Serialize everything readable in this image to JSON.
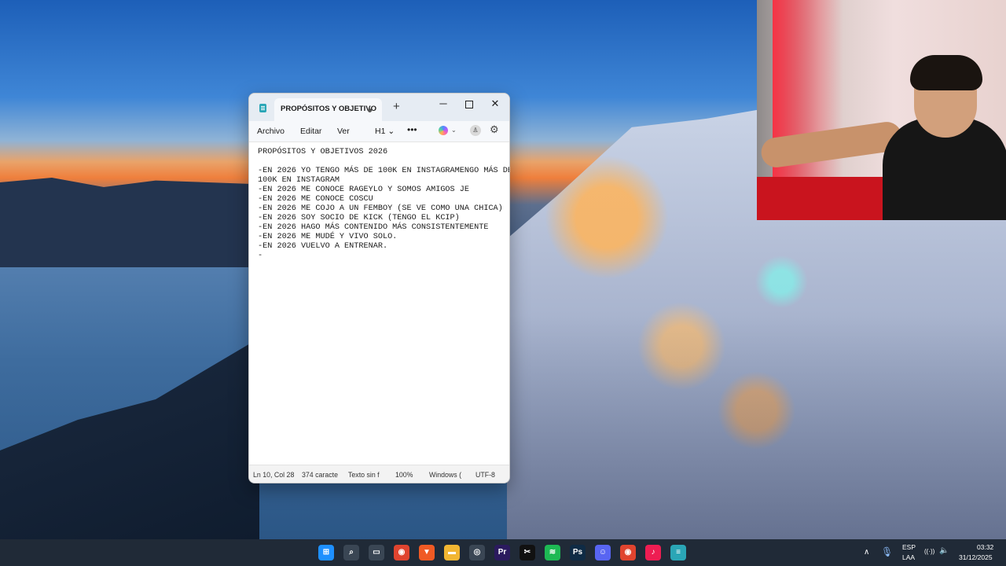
{
  "notepad": {
    "tab_title": "PROPÓSITOS Y OBJETIVO",
    "new_tab": "+",
    "window_controls": {
      "minimize": "─",
      "close": "✕"
    },
    "menu": {
      "archivo": "Archivo",
      "editar": "Editar",
      "ver": "Ver",
      "heading": "H1 ⌄",
      "more": "•••"
    },
    "content": "PROPÓSITOS Y OBJETIVOS 2026\n\n-EN 2026 YO TENGO MÁS DE 100K EN INSTAGRAMENGO MÁS DE\n100K EN INSTAGRAM\n-EN 2026 ME CONOCE RAGEYLO Y SOMOS AMIGOS JE\n-EN 2026 ME CONOCE COSCU\n-EN 2026 ME COJO A UN FEMBOY (SE VE COMO UNA CHICA)\n-EN 2026 SOY SOCIO DE KICK (TENGO EL KCIP)\n-EN 2026 HAGO MÁS CONTENIDO MÁS CONSISTENTEMENTE\n-EN 2026 ME MUDÉ Y VIVO SOLO.\n-EN 2026 VUELVO A ENTRENAR.\n-",
    "status": {
      "position": "Ln 10, Col 28",
      "chars": "374 caracte",
      "format": "Texto sin f",
      "zoom": "100%",
      "line_ending": "Windows (",
      "encoding": "UTF-8"
    }
  },
  "taskbar": {
    "icons": [
      {
        "name": "windows-start-icon",
        "glyph": "⊞",
        "color": "#1e90ff"
      },
      {
        "name": "search-icon",
        "glyph": "⌕",
        "color": "#3a4654"
      },
      {
        "name": "file-explorer-icon",
        "glyph": "▭",
        "color": "#3a4654"
      },
      {
        "name": "chrome-icon",
        "glyph": "◉",
        "color": "#e0442f"
      },
      {
        "name": "brave-icon",
        "glyph": "▼",
        "color": "#f05a24"
      },
      {
        "name": "folder-icon",
        "glyph": "▬",
        "color": "#f2b632"
      },
      {
        "name": "obs-icon",
        "glyph": "◎",
        "color": "#3a4654"
      },
      {
        "name": "premiere-icon",
        "glyph": "Pr",
        "color": "#2b1a5e"
      },
      {
        "name": "capcut-icon",
        "glyph": "✂",
        "color": "#111111"
      },
      {
        "name": "spotify-icon",
        "glyph": "≋",
        "color": "#1db954"
      },
      {
        "name": "photoshop-icon",
        "glyph": "Ps",
        "color": "#0f2b45"
      },
      {
        "name": "discord-icon",
        "glyph": "☺",
        "color": "#5865f2"
      },
      {
        "name": "chrome-2-icon",
        "glyph": "◉",
        "color": "#e0442f"
      },
      {
        "name": "tiktok-icon",
        "glyph": "♪",
        "color": "#ee1d52"
      },
      {
        "name": "notepad-icon",
        "glyph": "≡",
        "color": "#2aa6b6"
      }
    ],
    "tray": {
      "chevron": "∧",
      "lang_top": "ESP",
      "lang_bottom": "LAA",
      "wifi": "((·))",
      "volume": "🔈",
      "time": "03:32",
      "date": "31/12/2025"
    }
  }
}
